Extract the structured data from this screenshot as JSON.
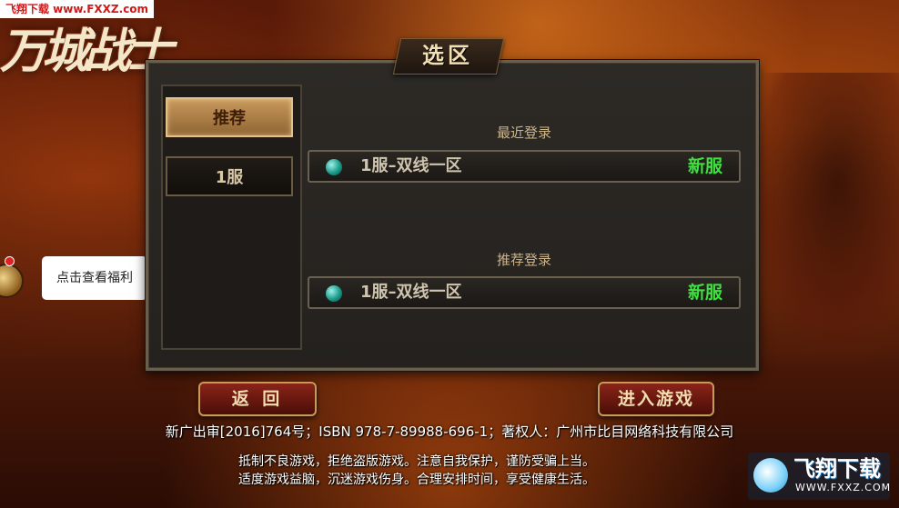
{
  "watermark_top": "飞翔下载 www.FXXZ.com",
  "game_logo": "万城战士",
  "tooltip": "点击查看福利",
  "panel": {
    "title": "选区",
    "tabs": [
      {
        "label": "推荐",
        "selected": true
      },
      {
        "label": "1服",
        "selected": false
      }
    ],
    "recent_section": {
      "label": "最近登录",
      "servers": [
        {
          "name": "1服–双线一区",
          "status": "新服"
        }
      ]
    },
    "recommended_section": {
      "label": "推荐登录",
      "servers": [
        {
          "name": "1服–双线一区",
          "status": "新服"
        }
      ]
    }
  },
  "buttons": {
    "back": "返 回",
    "enter": "进入游戏"
  },
  "license": "新广出审[2016]764号；ISBN 978-7-89988-696-1；著权人：广州市比目网络科技有限公司",
  "notice": {
    "line1": "抵制不良游戏，拒绝盗版游戏。注意自我保护，谨防受骗上当。",
    "line2": "适度游戏益脑，沉迷游戏伤身。合理安排时间，享受健康生活。"
  },
  "site_logo": {
    "text": "飞翔下载",
    "url": "WWW.FXXZ.COM"
  },
  "colors": {
    "new_server": "#3fe040",
    "selected_tab": "#c99a5e",
    "panel_bg": "#2d2a26",
    "button_red": "#8a2418"
  }
}
